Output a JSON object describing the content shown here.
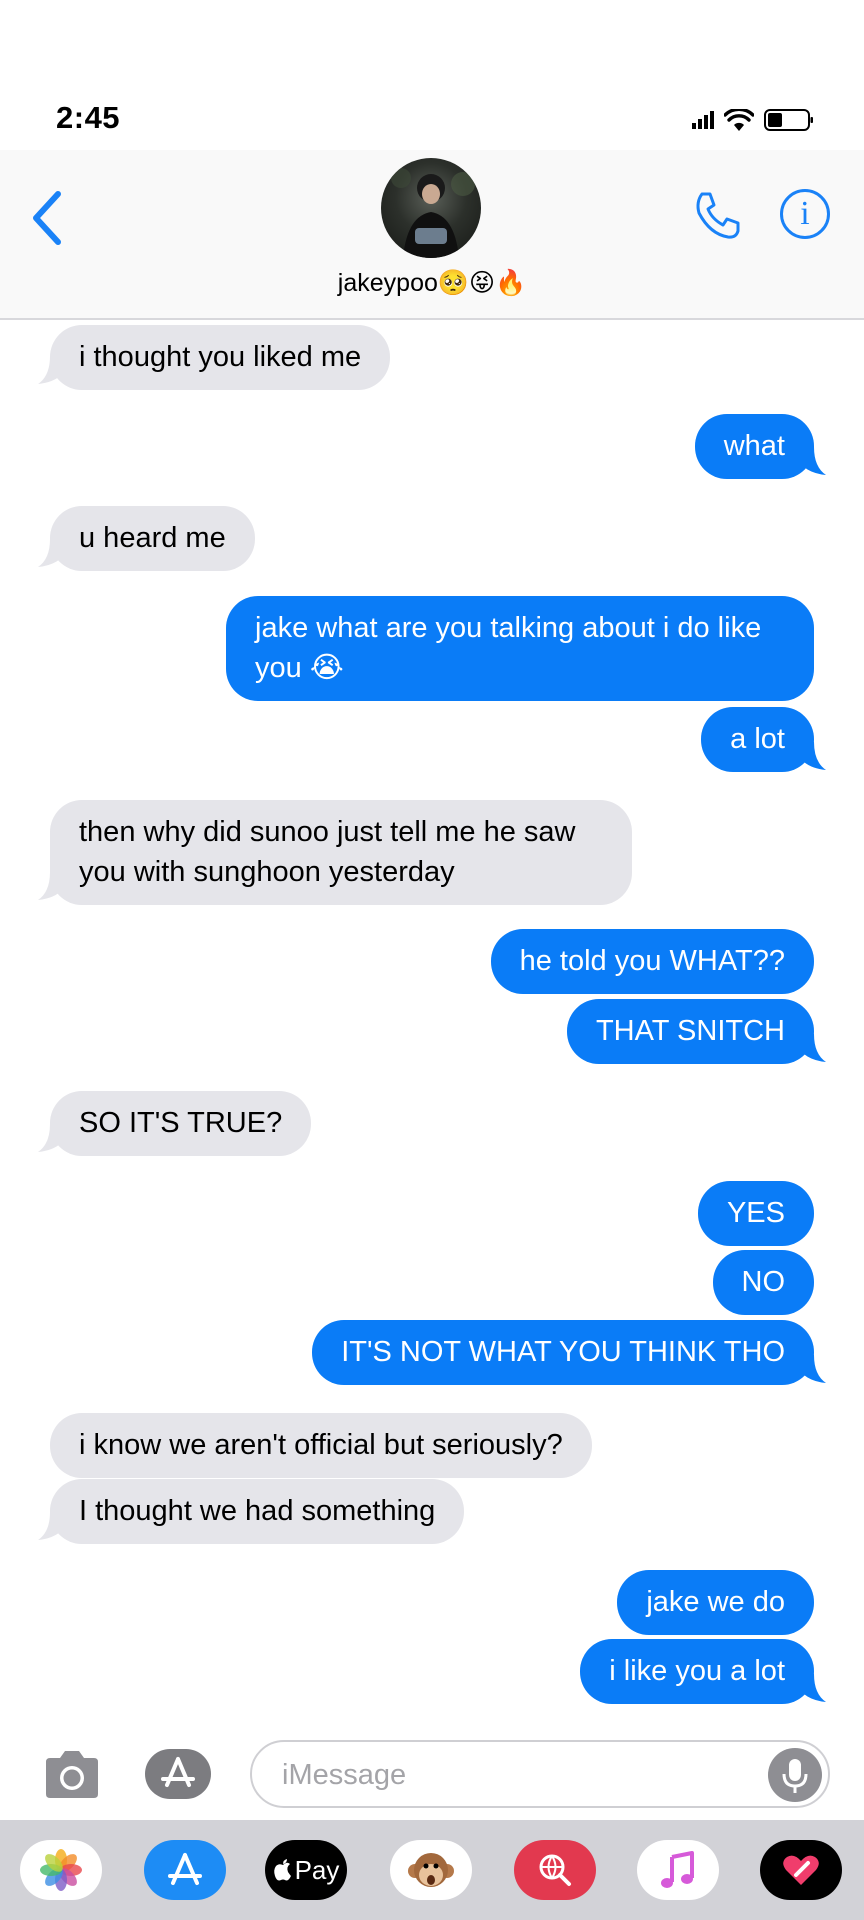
{
  "status_bar": {
    "time": "2:45"
  },
  "contact": {
    "name": "jakeypoo🥺😝🔥"
  },
  "messages": {
    "m1": "i thought you liked me",
    "m2": "what",
    "m3": "u heard me",
    "m4": "jake what are you talking about i do like you 😭",
    "m5": "a lot",
    "m6": "then why did sunoo just tell me he saw you with sunghoon yesterday",
    "m7": "he told you WHAT??",
    "m8": "THAT SNITCH",
    "m9": "SO IT'S TRUE?",
    "m10": "YES",
    "m11": "NO",
    "m12": "IT'S NOT WHAT YOU THINK THO",
    "m13": "i know we aren't official but seriously?",
    "m14": "I thought we had something",
    "m15": "jake we do",
    "m16": "i like you a lot"
  },
  "input": {
    "placeholder": "iMessage"
  },
  "apps": {
    "apple_pay_label": "Pay"
  },
  "colors": {
    "accent": "#0a7cf7",
    "incoming": "#e5e5ea",
    "icon_blue": "#1a82f7"
  }
}
